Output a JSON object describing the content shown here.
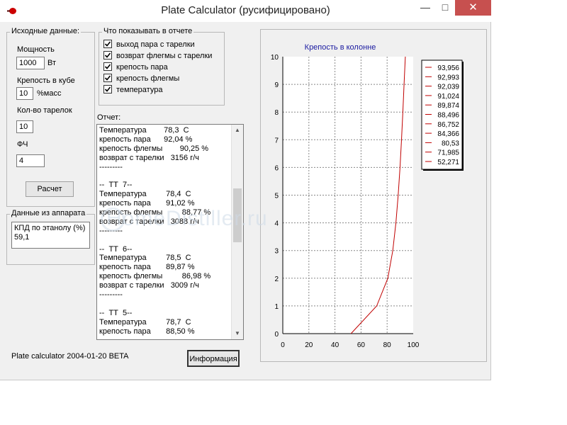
{
  "window": {
    "title": "Plate Calculator (русифицировано)",
    "minimize": "—",
    "maximize": "□",
    "close": "✕"
  },
  "input_group": {
    "label": "Исходные данные:",
    "power_label": "Мощность",
    "power_value": "1000",
    "power_unit": "Вт",
    "cube_label": "Крепость в кубе",
    "cube_value": "10",
    "cube_unit": "%масс",
    "plates_label": "Кол-во тарелок",
    "plates_value": "10",
    "fch_label": "ФЧ",
    "fch_value": "4",
    "calc_button": "Расчет"
  },
  "device_group": {
    "label": "Данные из аппарата",
    "kpd_label": "КПД по этанолу (%)",
    "kpd_value": "59,1"
  },
  "report_options": {
    "label": "Что показывать в отчете",
    "items": [
      {
        "label": "выход пара с тарелки",
        "checked": true
      },
      {
        "label": "возврат флегмы с тарелки",
        "checked": true
      },
      {
        "label": "крепость пара",
        "checked": true
      },
      {
        "label": "крепость флегмы",
        "checked": true
      },
      {
        "label": "температура",
        "checked": true
      }
    ]
  },
  "report": {
    "label": "Отчет:",
    "lines": [
      "Температура        78,3  С",
      "крепость пара      92,04 %",
      "крепость флегмы        90,25 %",
      "возврат с тарелки   3156 г/ч",
      "---------",
      "",
      "--  ТТ  7--",
      "Температура         78,4  С",
      "крепость пара       91,02 %",
      "крепость флегмы         88,77 %",
      "возврат с тарелки   3088 г/ч",
      "---------",
      "",
      "--  ТТ  6--",
      "Температура         78,5  С",
      "крепость пара       89,87 %",
      "крепость флегмы         86,98 %",
      "возврат с тарелки   3009 г/ч",
      "---------",
      "",
      "--  ТТ  5--",
      "Температура         78,7  С",
      "крепость пара       88,50 %"
    ]
  },
  "footer": {
    "version": "Plate calculator 2004-01-20 BETA",
    "info_button": "Информация"
  },
  "watermark": "HomeDistiller.ru",
  "chart_data": {
    "type": "line",
    "title": "Крепость в колонне",
    "xlim": [
      0,
      100
    ],
    "ylim": [
      0,
      10
    ],
    "x_ticks": [
      0,
      20,
      40,
      60,
      80,
      100
    ],
    "y_ticks": [
      0,
      1,
      2,
      3,
      4,
      5,
      6,
      7,
      8,
      9,
      10
    ],
    "grid": true,
    "legend_position": "right",
    "series_color": "#c00000",
    "series": [
      {
        "x": [
          52.271,
          71.985,
          80.53,
          84.366,
          86.752,
          88.496,
          89.874,
          91.024,
          92.039,
          92.993,
          93.956
        ],
        "y": [
          0,
          1,
          2,
          3,
          4,
          5,
          6,
          7,
          8,
          9,
          10
        ]
      }
    ],
    "legend_entries": [
      "93,956",
      "92,993",
      "92,039",
      "91,024",
      "89,874",
      "88,496",
      "86,752",
      "84,366",
      "80,53",
      "71,985",
      "52,271"
    ]
  }
}
